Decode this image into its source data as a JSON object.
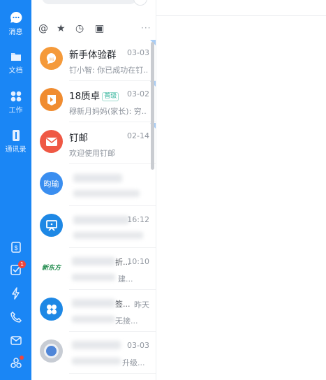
{
  "nav": {
    "items": [
      {
        "label": "消息",
        "icon": "chat-bubble-icon"
      },
      {
        "label": "文档",
        "icon": "folder-icon"
      },
      {
        "label": "工作",
        "icon": "apps-icon"
      },
      {
        "label": "通讯录",
        "icon": "contacts-icon"
      }
    ],
    "bottom_icons": [
      {
        "icon": "calendar-icon",
        "badge": ""
      },
      {
        "icon": "todo-check-icon",
        "badge": "1"
      },
      {
        "icon": "lightning-icon",
        "badge": ""
      },
      {
        "icon": "phone-icon",
        "badge": ""
      },
      {
        "icon": "mail-icon",
        "badge": ""
      },
      {
        "icon": "plugin-icon",
        "badge": "dot"
      }
    ],
    "accent": "#1a86f5"
  },
  "filters": [
    {
      "glyph": "@",
      "icon": "mention-icon"
    },
    {
      "glyph": "★",
      "icon": "star-icon"
    },
    {
      "glyph": "◷",
      "icon": "clock-icon"
    },
    {
      "glyph": "▣",
      "icon": "archive-icon"
    },
    {
      "glyph": "···",
      "icon": "more-icon"
    }
  ],
  "conversations": [
    {
      "name": "新手体验群",
      "tag": "",
      "time": "03-03",
      "preview": "钉小智: 你已成功在钉...",
      "avatar_color": "#f59a3a",
      "avatar_icon": "group-hi-icon"
    },
    {
      "name": "18质卓",
      "tag": "普级",
      "time": "03-02",
      "preview": "穆新月妈妈(家长): 穷...",
      "avatar_color": "#f08c30",
      "avatar_icon": "school-icon"
    },
    {
      "name": "钉邮",
      "tag": "",
      "time": "02-14",
      "preview": "欢迎使用钉邮",
      "avatar_color": "#ef5844",
      "avatar_icon": "envelope-icon"
    },
    {
      "name": "",
      "tag": "",
      "time": "",
      "preview": "",
      "avatar_color": "#3a8ef0",
      "avatar_text": "昀瑜",
      "avatar_icon": "text-avatar"
    },
    {
      "name": "",
      "tag": "",
      "time": "16:12",
      "preview": "",
      "avatar_color": "#1e88e5",
      "avatar_icon": "board-icon"
    },
    {
      "name": "",
      "tag": "",
      "time": "10:10",
      "preview": "建...",
      "name_tail": "折...",
      "avatar_color": "#ffffff",
      "avatar_text": "新东方",
      "avatar_icon": "brand-logo"
    },
    {
      "name": "",
      "tag": "",
      "time": "昨天",
      "preview": "无接...",
      "name_tail": "签...",
      "avatar_color": "#1e88e5",
      "avatar_icon": "four-petal-icon"
    },
    {
      "name": "",
      "tag": "",
      "time": "03-03",
      "preview": "升级...",
      "avatar_color": "#8b95a3",
      "avatar_icon": "ring-avatar"
    }
  ]
}
